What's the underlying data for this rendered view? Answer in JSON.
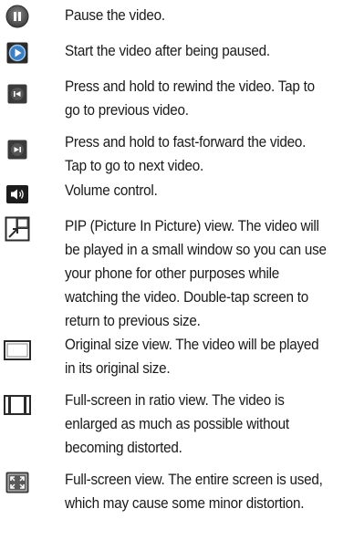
{
  "items": [
    {
      "icon": "pause-icon",
      "text": "Pause the video."
    },
    {
      "icon": "play-icon",
      "text": "Start the video after being paused."
    },
    {
      "icon": "rewind-icon",
      "text": "Press and hold to rewind the video. Tap to go to previous video."
    },
    {
      "icon": "fast-forward-icon",
      "text": "Press and hold to fast-forward the video. Tap to go to next video."
    },
    {
      "icon": "volume-icon",
      "text": "Volume control."
    },
    {
      "icon": "pip-icon",
      "text": "PIP (Picture In Picture) view. The video will be played in a small window so you can use your phone for other purposes while watching the video. Double-tap screen to return to previous size."
    },
    {
      "icon": "original-size-icon",
      "text": "Original size view. The video will be played in its original size."
    },
    {
      "icon": "ratio-fullscreen-icon",
      "text": "Full-screen in ratio view. The video is enlarged as much as possible without becoming distorted."
    },
    {
      "icon": "fullscreen-icon",
      "text": "Full-screen view. The entire screen is used, which may cause some minor distortion."
    }
  ]
}
